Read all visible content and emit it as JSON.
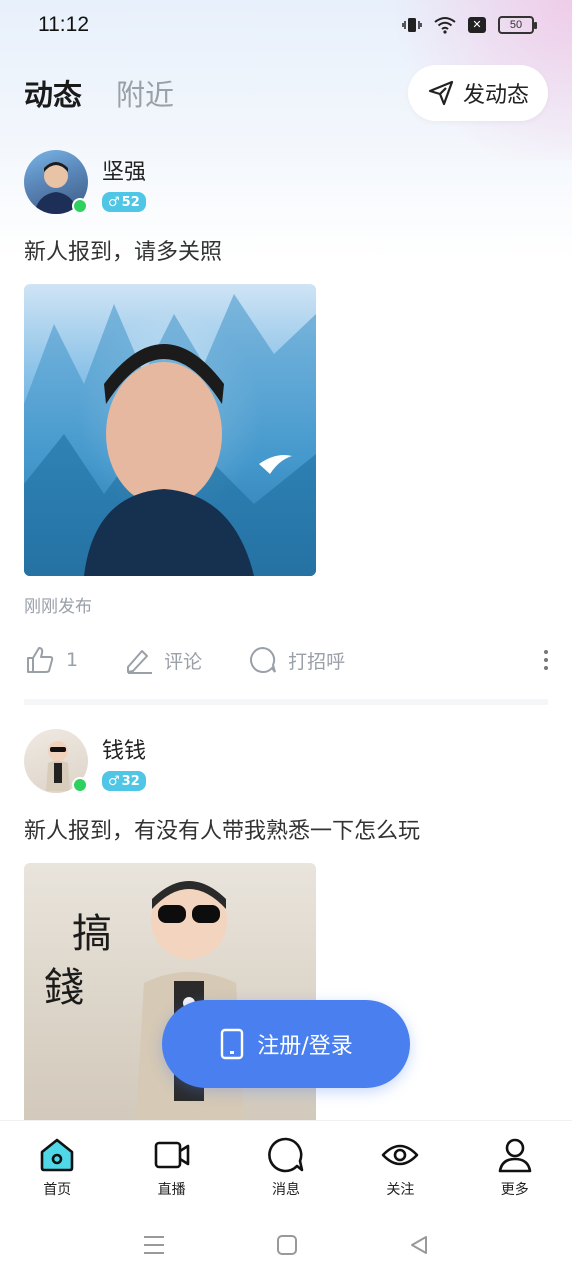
{
  "status": {
    "time": "11:12",
    "battery": "50"
  },
  "header": {
    "tabs": [
      {
        "label": "动态"
      },
      {
        "label": "附近"
      }
    ],
    "post_button": "发动态"
  },
  "posts": [
    {
      "username": "坚强",
      "age": "52",
      "text": "新人报到，请多关照",
      "time": "刚刚发布",
      "likes": "1",
      "comment_label": "评论",
      "greet_label": "打招呼"
    },
    {
      "username": "钱钱",
      "age": "32",
      "text": "新人报到，有没有人带我熟悉一下怎么玩",
      "image_text_1": "搞",
      "image_text_2": "錢"
    }
  ],
  "login_button": "注册/登录",
  "tabbar": [
    {
      "label": "首页",
      "icon": "home-icon"
    },
    {
      "label": "直播",
      "icon": "video-camera-icon"
    },
    {
      "label": "消息",
      "icon": "message-bubble-icon"
    },
    {
      "label": "关注",
      "icon": "eye-icon"
    },
    {
      "label": "更多",
      "icon": "person-icon"
    }
  ],
  "colors": {
    "accent": "#4a7ff0",
    "online": "#2ed15f",
    "gender_tag": "#4fc6e6",
    "home_active": "#4fd8e8"
  }
}
